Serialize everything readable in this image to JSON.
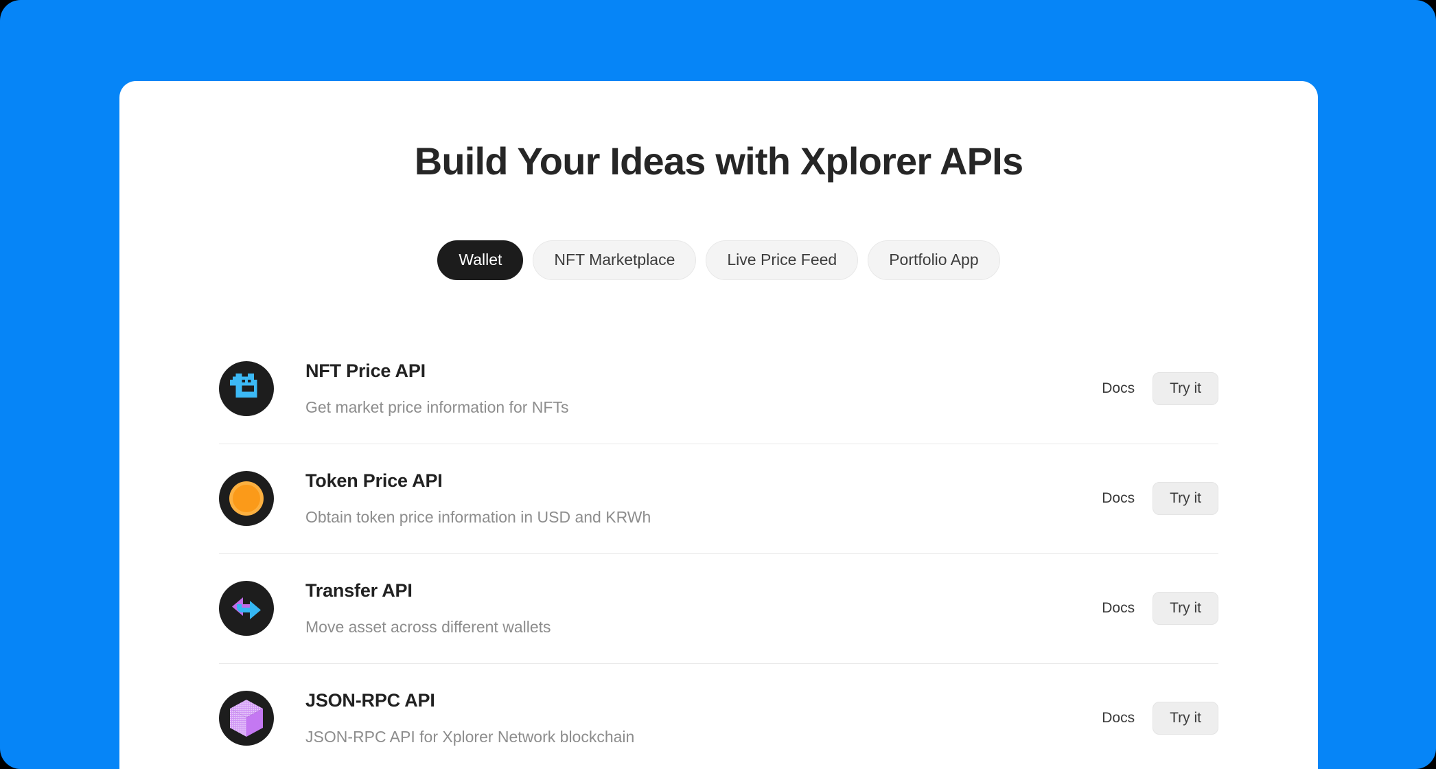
{
  "theme": {
    "page_background": "#0685f7",
    "card_background": "#ffffff",
    "accent_dark": "#1c1c1c",
    "muted_text": "#8d8d8d",
    "divider": "#e9e9e9"
  },
  "hero": {
    "title": "Build Your Ideas with Xplorer APIs"
  },
  "tabs": [
    {
      "label": "Wallet",
      "active": true
    },
    {
      "label": "NFT Marketplace",
      "active": false
    },
    {
      "label": "Live Price Feed",
      "active": false
    },
    {
      "label": "Portfolio App",
      "active": false
    }
  ],
  "actions": {
    "docs_label": "Docs",
    "try_label": "Try it"
  },
  "apis": [
    {
      "icon": "pixel-punk-head-icon",
      "icon_color": "#3cb9f5",
      "name": "NFT Price API",
      "description": "Get market price information for NFTs"
    },
    {
      "icon": "orange-token-circle-icon",
      "icon_color": "#fb9a19",
      "name": "Token Price API",
      "description": "Obtain token price information in USD and KRWh"
    },
    {
      "icon": "transfer-arrows-icon",
      "icon_color": "#c06bea",
      "icon_color_secondary": "#35b6f3",
      "name": "Transfer API",
      "description": "Move asset across different wallets"
    },
    {
      "icon": "purple-cube-icon",
      "icon_color": "#c478f2",
      "name": "JSON-RPC API",
      "description": "JSON-RPC API for Xplorer Network blockchain"
    }
  ]
}
